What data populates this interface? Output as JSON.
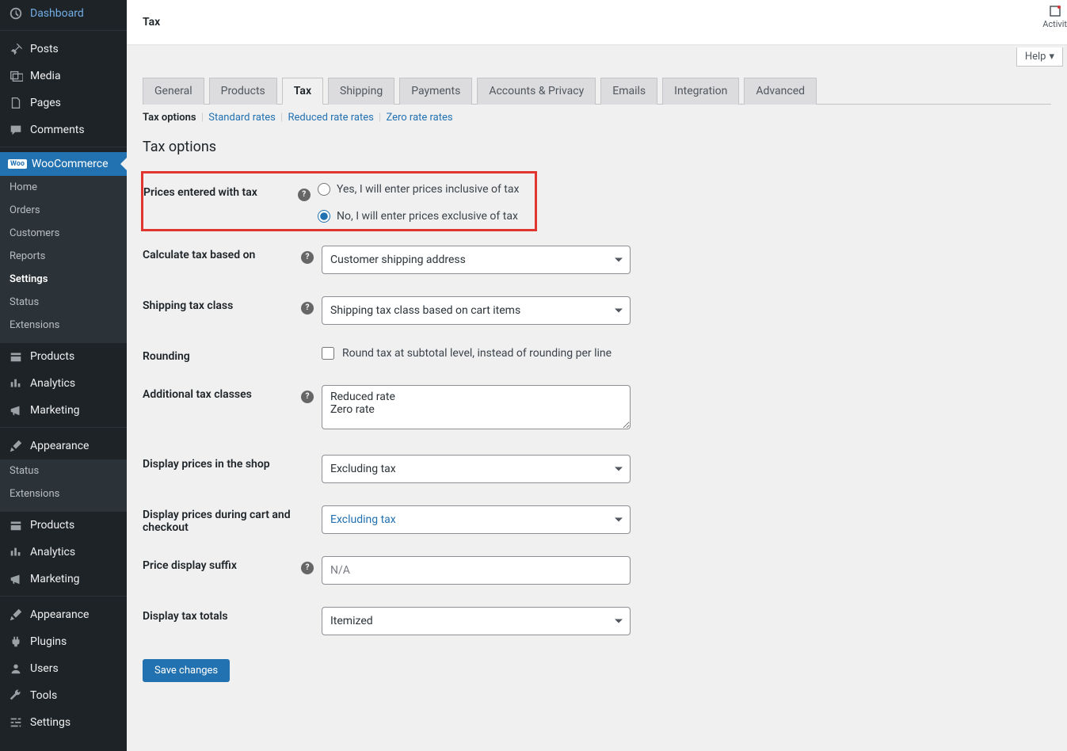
{
  "sidebar": {
    "items": [
      {
        "label": "Dashboard"
      },
      {
        "label": "Posts"
      },
      {
        "label": "Media"
      },
      {
        "label": "Pages"
      },
      {
        "label": "Comments"
      },
      {
        "label": "WooCommerce"
      },
      {
        "label": "Home"
      },
      {
        "label": "Orders"
      },
      {
        "label": "Customers"
      },
      {
        "label": "Reports"
      },
      {
        "label": "Settings"
      },
      {
        "label": "Status"
      },
      {
        "label": "Extensions"
      },
      {
        "label": "Products"
      },
      {
        "label": "Analytics"
      },
      {
        "label": "Marketing"
      },
      {
        "label": "Appearance"
      },
      {
        "label": "Status"
      },
      {
        "label": "Extensions"
      },
      {
        "label": "Products"
      },
      {
        "label": "Analytics"
      },
      {
        "label": "Marketing"
      },
      {
        "label": "Appearance"
      },
      {
        "label": "Plugins"
      },
      {
        "label": "Users"
      },
      {
        "label": "Tools"
      },
      {
        "label": "Settings"
      }
    ]
  },
  "topbar": {
    "title": "Tax",
    "activity": "Activit",
    "help": "Help"
  },
  "tabs": [
    "General",
    "Products",
    "Tax",
    "Shipping",
    "Payments",
    "Accounts & Privacy",
    "Emails",
    "Integration",
    "Advanced"
  ],
  "active_tab": "Tax",
  "subnav": {
    "active": "Tax options",
    "links": [
      "Standard rates",
      "Reduced rate rates",
      "Zero rate rates"
    ]
  },
  "section_title": "Tax options",
  "fields": {
    "prices_tax": {
      "label": "Prices entered with tax",
      "opt_yes": "Yes, I will enter prices inclusive of tax",
      "opt_no": "No, I will enter prices exclusive of tax"
    },
    "calc": {
      "label": "Calculate tax based on",
      "value": "Customer shipping address"
    },
    "shipclass": {
      "label": "Shipping tax class",
      "value": "Shipping tax class based on cart items"
    },
    "rounding": {
      "label": "Rounding",
      "desc": "Round tax at subtotal level, instead of rounding per line"
    },
    "addclasses": {
      "label": "Additional tax classes",
      "value": "Reduced rate\nZero rate"
    },
    "shop_prices": {
      "label": "Display prices in the shop",
      "value": "Excluding tax"
    },
    "cart_prices": {
      "label": "Display prices during cart and checkout",
      "value": "Excluding tax"
    },
    "suffix": {
      "label": "Price display suffix",
      "placeholder": "N/A"
    },
    "totals": {
      "label": "Display tax totals",
      "value": "Itemized"
    }
  },
  "save": "Save changes",
  "woo_badge": "Woo"
}
